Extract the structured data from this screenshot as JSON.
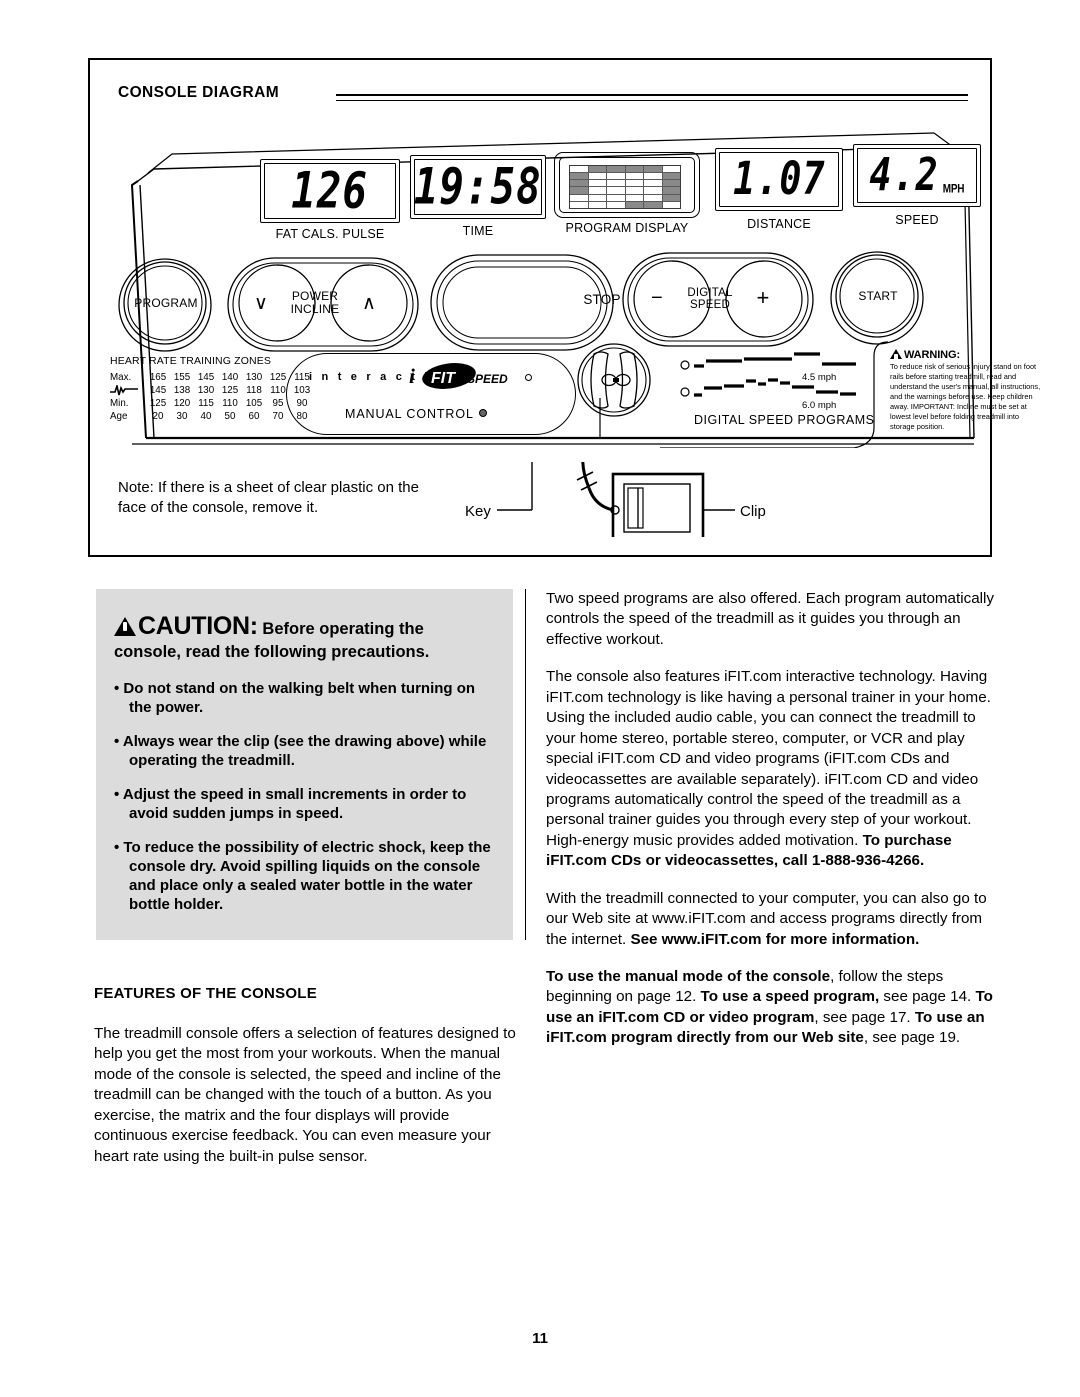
{
  "page": {
    "number": "11"
  },
  "console_diagram": {
    "title": "CONSOLE DIAGRAM",
    "displays": [
      {
        "value": "126",
        "label": "FAT   CALS.  PULSE",
        "name": "fat-cals-pulse-display"
      },
      {
        "value": "19:58",
        "label": "TIME",
        "name": "time-display"
      },
      {
        "value": "",
        "label": "PROGRAM DISPLAY",
        "name": "program-display"
      },
      {
        "value": "1.07",
        "label": "DISTANCE",
        "name": "distance-display"
      },
      {
        "value": "4.2",
        "unit": "MPH",
        "label": "SPEED",
        "name": "speed-display"
      }
    ],
    "matrix": [
      [
        0,
        1,
        1,
        1,
        1,
        0
      ],
      [
        1,
        0,
        0,
        0,
        0,
        1
      ],
      [
        1,
        0,
        0,
        0,
        0,
        1
      ],
      [
        1,
        0,
        0,
        0,
        0,
        1
      ],
      [
        0,
        0,
        0,
        0,
        0,
        1
      ],
      [
        0,
        0,
        0,
        1,
        1,
        0
      ]
    ],
    "buttons": {
      "program": "PROGRAM",
      "power_incline_line1": "POWER",
      "power_incline_line2": "INCLINE",
      "incline_down": "∨",
      "incline_up": "∧",
      "stop": "STOP",
      "digital_speed_line1": "DIGITAL",
      "digital_speed_line2": "SPEED",
      "speed_minus": "−",
      "speed_plus": "+",
      "start": "START"
    },
    "heart_rate": {
      "title": "HEART RATE TRAINING ZONES",
      "rows": [
        {
          "label": "Max.",
          "values": [
            "165",
            "155",
            "145",
            "140",
            "130",
            "125",
            "115"
          ]
        },
        {
          "label": "ekg-icon",
          "values": [
            "145",
            "138",
            "130",
            "125",
            "118",
            "110",
            "103"
          ]
        },
        {
          "label": "Min.",
          "values": [
            "125",
            "120",
            "115",
            "110",
            "105",
            "95",
            "90"
          ]
        },
        {
          "label": "Age",
          "values": [
            "20",
            "30",
            "40",
            "50",
            "60",
            "70",
            "80"
          ]
        }
      ]
    },
    "ifit_panel": {
      "interactive_word": "i n t e r a c t i v e",
      "logo_i": "i",
      "logo_fit": "FIT",
      "logo_speed": "SPEED",
      "manual_control": "MANUAL CONTROL"
    },
    "digital_speed_programs": {
      "label": "DIGITAL SPEED PROGRAMS",
      "program_1_mph": "4.5 mph",
      "program_2_mph": "6.0 mph"
    },
    "warning": {
      "heading": "WARNING:",
      "body": "To reduce risk of serious injury, stand on foot rails before starting treadmill, read and understand the user's manual, all instructions, and the warnings before use.  Keep children away.  IMPORTANT: Incline must be set at lowest level before folding treadmill into storage position."
    },
    "note": "Note: If there is a sheet of clear plastic on the face of the console, remove it.",
    "key_label": "Key",
    "clip_label": "Clip"
  },
  "caution": {
    "heading_word": "CAUTION",
    "heading_colon": ":",
    "heading_rest": "Before operating the console, read the following precautions.",
    "items": [
      "Do not stand on the walking belt when turning on the power.",
      "Always wear the clip (see the drawing above) while operating the treadmill.",
      "Adjust the speed in small increments in order to avoid sudden jumps in speed.",
      "To reduce the possibility of electric shock, keep the console dry. Avoid spilling liquids on the console and place only a sealed water bottle in the water bottle holder."
    ]
  },
  "features": {
    "heading": "FEATURES OF THE CONSOLE",
    "paragraph": "The treadmill console offers a selection of features designed to help you get the most from your workouts. When the manual mode of the console is selected, the speed and incline of the treadmill can be changed with the touch of a button. As you exercise, the matrix and the four displays will provide continuous exercise feedback. You can even measure your heart rate using the built-in pulse sensor."
  },
  "right_column": {
    "p1": "Two speed programs are also offered. Each program automatically controls the speed of the treadmill as it guides you through an effective workout.",
    "p2_plain": "The console also features iFIT.com interactive technology. Having iFIT.com technology is like having a personal trainer in your home. Using the included audio cable, you can connect the treadmill to your home stereo, portable stereo, computer, or VCR and play special iFIT.com CD and video programs (iFIT.com CDs and videocassettes are available separately). iFIT.com CD and video programs automatically control the speed of the treadmill as a personal trainer guides you through every step of your workout. High-energy music provides added motivation. ",
    "p2_bold": "To purchase iFIT.com CDs or videocassettes, call 1-888-936-4266.",
    "p3_plain": "With the treadmill connected to your computer, you can also go to our Web site at www.iFIT.com and access programs directly from the internet. ",
    "p3_bold": "See www.iFIT.com for more information.",
    "p4_b1": "To use the manual mode of the console",
    "p4_t1": ", follow the steps beginning on page 12. ",
    "p4_b2": "To use a speed program,",
    "p4_t2": " see page 14. ",
    "p4_b3": "To use an iFIT.com CD or video program",
    "p4_t3": ", see page 17. ",
    "p4_b4": "To use an iFIT.com program directly from our Web site",
    "p4_t4": ", see page 19."
  }
}
